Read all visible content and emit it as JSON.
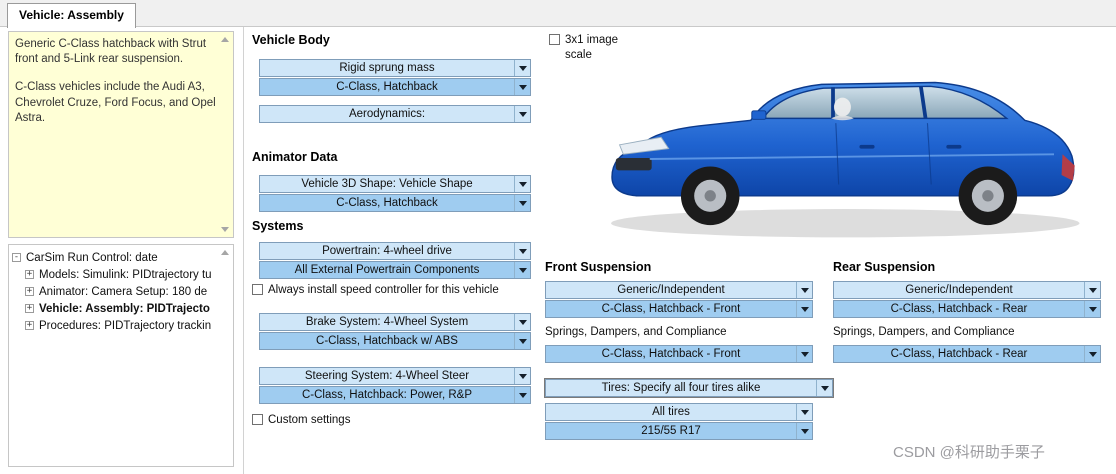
{
  "tab": {
    "label": "Vehicle: Assembly"
  },
  "notes": {
    "paragraph1": "Generic C-Class hatchback with Strut front and 5-Link rear suspension.",
    "paragraph2": "C-Class vehicles include the Audi A3, Chevrolet Cruze, Ford Focus, and Opel Astra."
  },
  "tree": {
    "items": [
      {
        "expander": "-",
        "label": "CarSim Run Control: date"
      },
      {
        "expander": "+",
        "label": "Models: Simulink: PIDtrajectory tu"
      },
      {
        "expander": "+",
        "label": "Animator: Camera Setup: 180 de"
      },
      {
        "expander": "+",
        "label": "Vehicle: Assembly: PIDTrajecto"
      },
      {
        "expander": "+",
        "label": "Procedures: PIDTrajectory trackin"
      }
    ]
  },
  "vehicle_body": {
    "heading": "Vehicle Body",
    "type": "Rigid sprung mass",
    "dataset": "C-Class, Hatchback",
    "aero": "Aerodynamics:"
  },
  "animator": {
    "heading": "Animator Data",
    "shape": "Vehicle 3D Shape: Vehicle Shape",
    "dataset": "C-Class, Hatchback"
  },
  "systems": {
    "heading": "Systems",
    "powertrain": "Powertrain: 4-wheel drive",
    "powertrain_dataset": "All External Powertrain Components",
    "speed_controller": "Always install speed controller for this vehicle",
    "brakes": "Brake System: 4-Wheel System",
    "brakes_dataset": "C-Class, Hatchback w/ ABS",
    "steering": "Steering System: 4-Wheel Steer",
    "steering_dataset": "C-Class, Hatchback: Power, R&P",
    "custom_settings": "Custom settings"
  },
  "image_area": {
    "scale_checkbox": "3x1 image scale"
  },
  "front_suspension": {
    "heading": "Front Suspension",
    "type": "Generic/Independent",
    "dataset": "C-Class, Hatchback - Front",
    "springs_label": "Springs, Dampers, and Compliance",
    "springs_dataset": "C-Class, Hatchback - Front"
  },
  "rear_suspension": {
    "heading": "Rear Suspension",
    "type": "Generic/Independent",
    "dataset": "C-Class, Hatchback - Rear",
    "springs_label": "Springs, Dampers, and Compliance",
    "springs_dataset": "C-Class, Hatchback - Rear"
  },
  "tires": {
    "type": "Tires: Specify all four tires alike",
    "group": "All tires",
    "size": "215/55 R17"
  },
  "watermark": "CSDN @科研助手栗子",
  "colors": {
    "dropdown_light": "#cfe6f8",
    "dropdown_selected": "#9fccf0",
    "note_background": "#ffffd6",
    "car_blue": "#1f63d0"
  }
}
